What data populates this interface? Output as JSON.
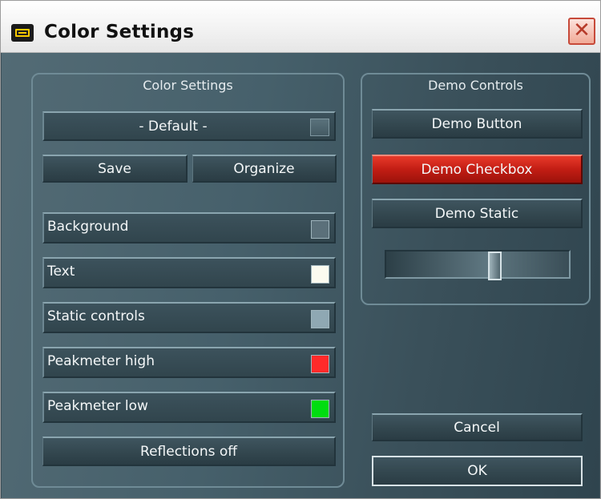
{
  "window": {
    "title": "Color Settings",
    "close_symbol": "✕"
  },
  "color_settings": {
    "group_title": "Color Settings",
    "preset": {
      "selected": "- Default -"
    },
    "save_label": "Save",
    "organize_label": "Organize",
    "items": [
      {
        "label": "Background",
        "color": "#5b707a"
      },
      {
        "label": "Text",
        "color": "#fbfbf0"
      },
      {
        "label": "Static controls",
        "color": "#8fa8b3"
      },
      {
        "label": "Peakmeter high",
        "color": "#ff2a2a"
      },
      {
        "label": "Peakmeter low",
        "color": "#00dd10"
      }
    ],
    "reflections_label": "Reflections off"
  },
  "demo_controls": {
    "group_title": "Demo Controls",
    "button_label": "Demo Button",
    "checkbox_label": "Demo Checkbox",
    "static_label": "Demo Static",
    "slider_value": 0.6
  },
  "actions": {
    "cancel_label": "Cancel",
    "ok_label": "OK"
  },
  "icons": {
    "app": "app-icon",
    "close": "close-icon"
  }
}
